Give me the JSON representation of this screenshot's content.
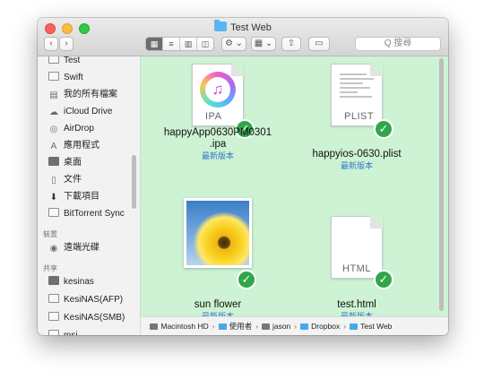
{
  "window": {
    "title": "Test Web",
    "nav": {
      "back": "‹",
      "forward": "›"
    },
    "view_icons": [
      "grid-view-icon",
      "list-view-icon",
      "column-view-icon",
      "coverflow-view-icon"
    ],
    "action_label": "⚙ ⌄",
    "arrange_label": "▦ ⌄",
    "share_label": "⇧",
    "tag_label": "▭",
    "search_placeholder": "Q 搜尋"
  },
  "sidebar": {
    "favorites": [
      {
        "label": "Test",
        "icon": "folder-icon"
      },
      {
        "label": "Swift",
        "icon": "folder-icon"
      },
      {
        "label": "我的所有檔案",
        "icon": "all-files-icon"
      },
      {
        "label": "iCloud Drive",
        "icon": "cloud-icon"
      },
      {
        "label": "AirDrop",
        "icon": "airdrop-icon"
      },
      {
        "label": "應用程式",
        "icon": "applications-icon"
      },
      {
        "label": "桌面",
        "icon": "desktop-icon"
      },
      {
        "label": "文件",
        "icon": "documents-icon"
      },
      {
        "label": "下載項目",
        "icon": "downloads-icon"
      },
      {
        "label": "BitTorrent Sync",
        "icon": "folder-icon"
      }
    ],
    "devices_heading": "裝置",
    "devices": [
      {
        "label": "遠端光碟",
        "icon": "remote-disc-icon"
      }
    ],
    "shared_heading": "共享",
    "shared": [
      {
        "label": "kesinas",
        "icon": "server-icon"
      },
      {
        "label": "KesiNAS(AFP)",
        "icon": "server-icon"
      },
      {
        "label": "KesiNAS(SMB)",
        "icon": "server-icon"
      },
      {
        "label": "msi",
        "icon": "server-icon"
      }
    ]
  },
  "files": [
    {
      "name_line1": "happyApp0630PM0301",
      "name_line2": ".ipa",
      "status": "最新版本",
      "doc_label": "IPA",
      "kind": "ipa"
    },
    {
      "name_line1": "happyios-0630.plist",
      "name_line2": "",
      "status": "最新版本",
      "doc_label": "PLIST",
      "kind": "plist"
    },
    {
      "name_line1": "sun flower",
      "name_line2": "",
      "status": "最新版本",
      "doc_label": "",
      "kind": "image"
    },
    {
      "name_line1": "test.html",
      "name_line2": "",
      "status": "最新版本",
      "doc_label": "HTML",
      "kind": "html"
    }
  ],
  "pathbar": [
    "Macintosh HD",
    "使用者",
    "jason",
    "Dropbox",
    "Test Web"
  ],
  "colors": {
    "content_bg": "#cdf2d4",
    "sync_check": "#30a64a",
    "status_text": "#3478c8",
    "folder_blue": "#5ab6f0"
  }
}
